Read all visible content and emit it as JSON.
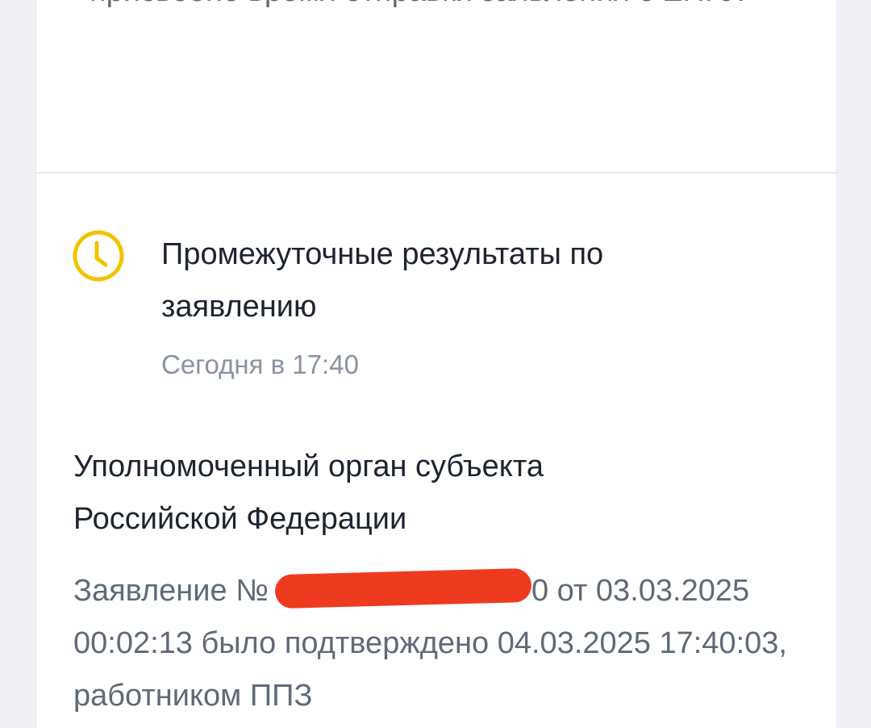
{
  "previous_event": {
    "text": "присвоено время отправки заявления с ЕПГУ."
  },
  "event": {
    "icon": "clock-icon",
    "icon_color": "#f2c300",
    "title": "Промежуточные результаты по заявлению",
    "time": "Сегодня в 17:40"
  },
  "details": {
    "org_name": "Уполномоченный орган субъекта Российской Федерации",
    "application_prefix": "Заявление №",
    "application_suffix": "0 от",
    "application_body": "03.03.2025 00:02:13 было подтверждено 04.03.2025 17:40:03, работником ППЗ",
    "redaction_color": "#ee3b1f"
  }
}
